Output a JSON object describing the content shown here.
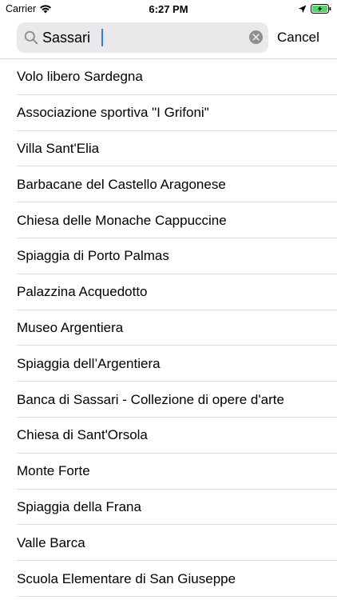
{
  "status_bar": {
    "carrier": "Carrier",
    "time": "6:27 PM"
  },
  "search": {
    "value": "Sassari",
    "cancel_label": "Cancel"
  },
  "results": [
    {
      "label": "Volo libero Sardegna"
    },
    {
      "label": "Associazione sportiva \"I Grifoni\""
    },
    {
      "label": "Villa Sant'Elia"
    },
    {
      "label": "Barbacane del Castello Aragonese"
    },
    {
      "label": "Chiesa delle Monache Cappuccine"
    },
    {
      "label": "Spiaggia di Porto Palmas"
    },
    {
      "label": "Palazzina Acquedotto"
    },
    {
      "label": "Museo Argentiera"
    },
    {
      "label": "Spiaggia dell’Argentiera"
    },
    {
      "label": "Banca di Sassari - Collezione di opere d'arte"
    },
    {
      "label": "Chiesa di Sant'Orsola"
    },
    {
      "label": "Monte Forte"
    },
    {
      "label": "Spiaggia della Frana"
    },
    {
      "label": "Valle Barca"
    },
    {
      "label": "Scuola Elementare di San Giuseppe"
    }
  ],
  "icons": {
    "wifi": "wifi-icon",
    "location": "location-arrow-icon",
    "battery": "battery-charging-icon",
    "search": "search-icon",
    "clear": "clear-icon"
  },
  "colors": {
    "accent": "#2f7cf6",
    "battery_fill": "#4cd964",
    "search_field_bg": "#e9e9eb"
  }
}
